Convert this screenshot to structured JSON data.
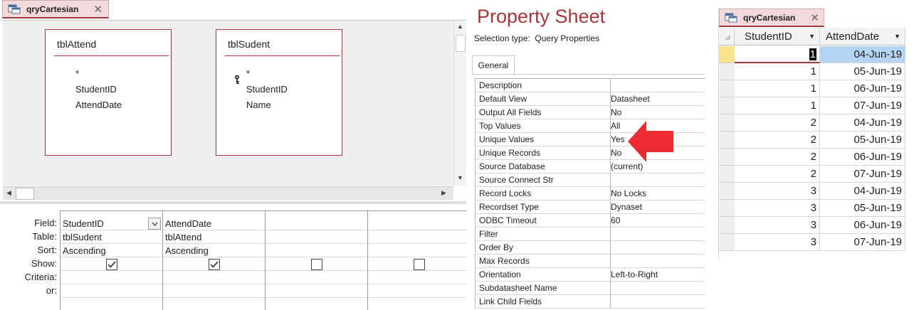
{
  "designer": {
    "tab_title": "qryCartesian",
    "tables": [
      {
        "name": "tblAttend",
        "fields": [
          "*",
          "StudentID",
          "AttendDate"
        ]
      },
      {
        "name": "tblSudent",
        "fields": [
          "*",
          "StudentID",
          "Name"
        ],
        "key_field": "StudentID"
      }
    ],
    "grid": {
      "row_labels": [
        "Field:",
        "Table:",
        "Sort:",
        "Show:",
        "Criteria:",
        "or:"
      ],
      "columns": [
        {
          "field": "StudentID",
          "table": "tblSudent",
          "sort": "Ascending",
          "show": true
        },
        {
          "field": "AttendDate",
          "table": "tblAttend",
          "sort": "Ascending",
          "show": true
        },
        {
          "field": "",
          "table": "",
          "sort": "",
          "show": false
        },
        {
          "field": "",
          "table": "",
          "sort": "",
          "show": false
        }
      ]
    }
  },
  "property_sheet": {
    "title": "Property Sheet",
    "selection_label": "Selection type:",
    "selection_value": "Query Properties",
    "tab": "General",
    "rows": [
      {
        "name": "Description",
        "value": ""
      },
      {
        "name": "Default View",
        "value": "Datasheet"
      },
      {
        "name": "Output All Fields",
        "value": "No"
      },
      {
        "name": "Top Values",
        "value": "All"
      },
      {
        "name": "Unique Values",
        "value": "Yes"
      },
      {
        "name": "Unique Records",
        "value": "No"
      },
      {
        "name": "Source Database",
        "value": "(current)"
      },
      {
        "name": "Source Connect Str",
        "value": ""
      },
      {
        "name": "Record Locks",
        "value": "No Locks"
      },
      {
        "name": "Recordset Type",
        "value": "Dynaset"
      },
      {
        "name": "ODBC Timeout",
        "value": "60"
      },
      {
        "name": "Filter",
        "value": ""
      },
      {
        "name": "Order By",
        "value": ""
      },
      {
        "name": "Max Records",
        "value": ""
      },
      {
        "name": "Orientation",
        "value": "Left-to-Right"
      },
      {
        "name": "Subdatasheet Name",
        "value": ""
      },
      {
        "name": "Link Child Fields",
        "value": ""
      }
    ],
    "highlight_color": "#ee2a32"
  },
  "datasheet": {
    "tab_title": "qryCartesian",
    "columns": [
      "StudentID",
      "AttendDate"
    ],
    "rows": [
      [
        "1",
        "04-Jun-19"
      ],
      [
        "1",
        "05-Jun-19"
      ],
      [
        "1",
        "06-Jun-19"
      ],
      [
        "1",
        "07-Jun-19"
      ],
      [
        "2",
        "04-Jun-19"
      ],
      [
        "2",
        "05-Jun-19"
      ],
      [
        "2",
        "06-Jun-19"
      ],
      [
        "2",
        "07-Jun-19"
      ],
      [
        "3",
        "04-Jun-19"
      ],
      [
        "3",
        "05-Jun-19"
      ],
      [
        "3",
        "06-Jun-19"
      ],
      [
        "3",
        "07-Jun-19"
      ]
    ]
  },
  "colors": {
    "accent": "#a4373a",
    "tab_bg": "#f4d9dc",
    "selected_cell": "#b5d3f2"
  }
}
